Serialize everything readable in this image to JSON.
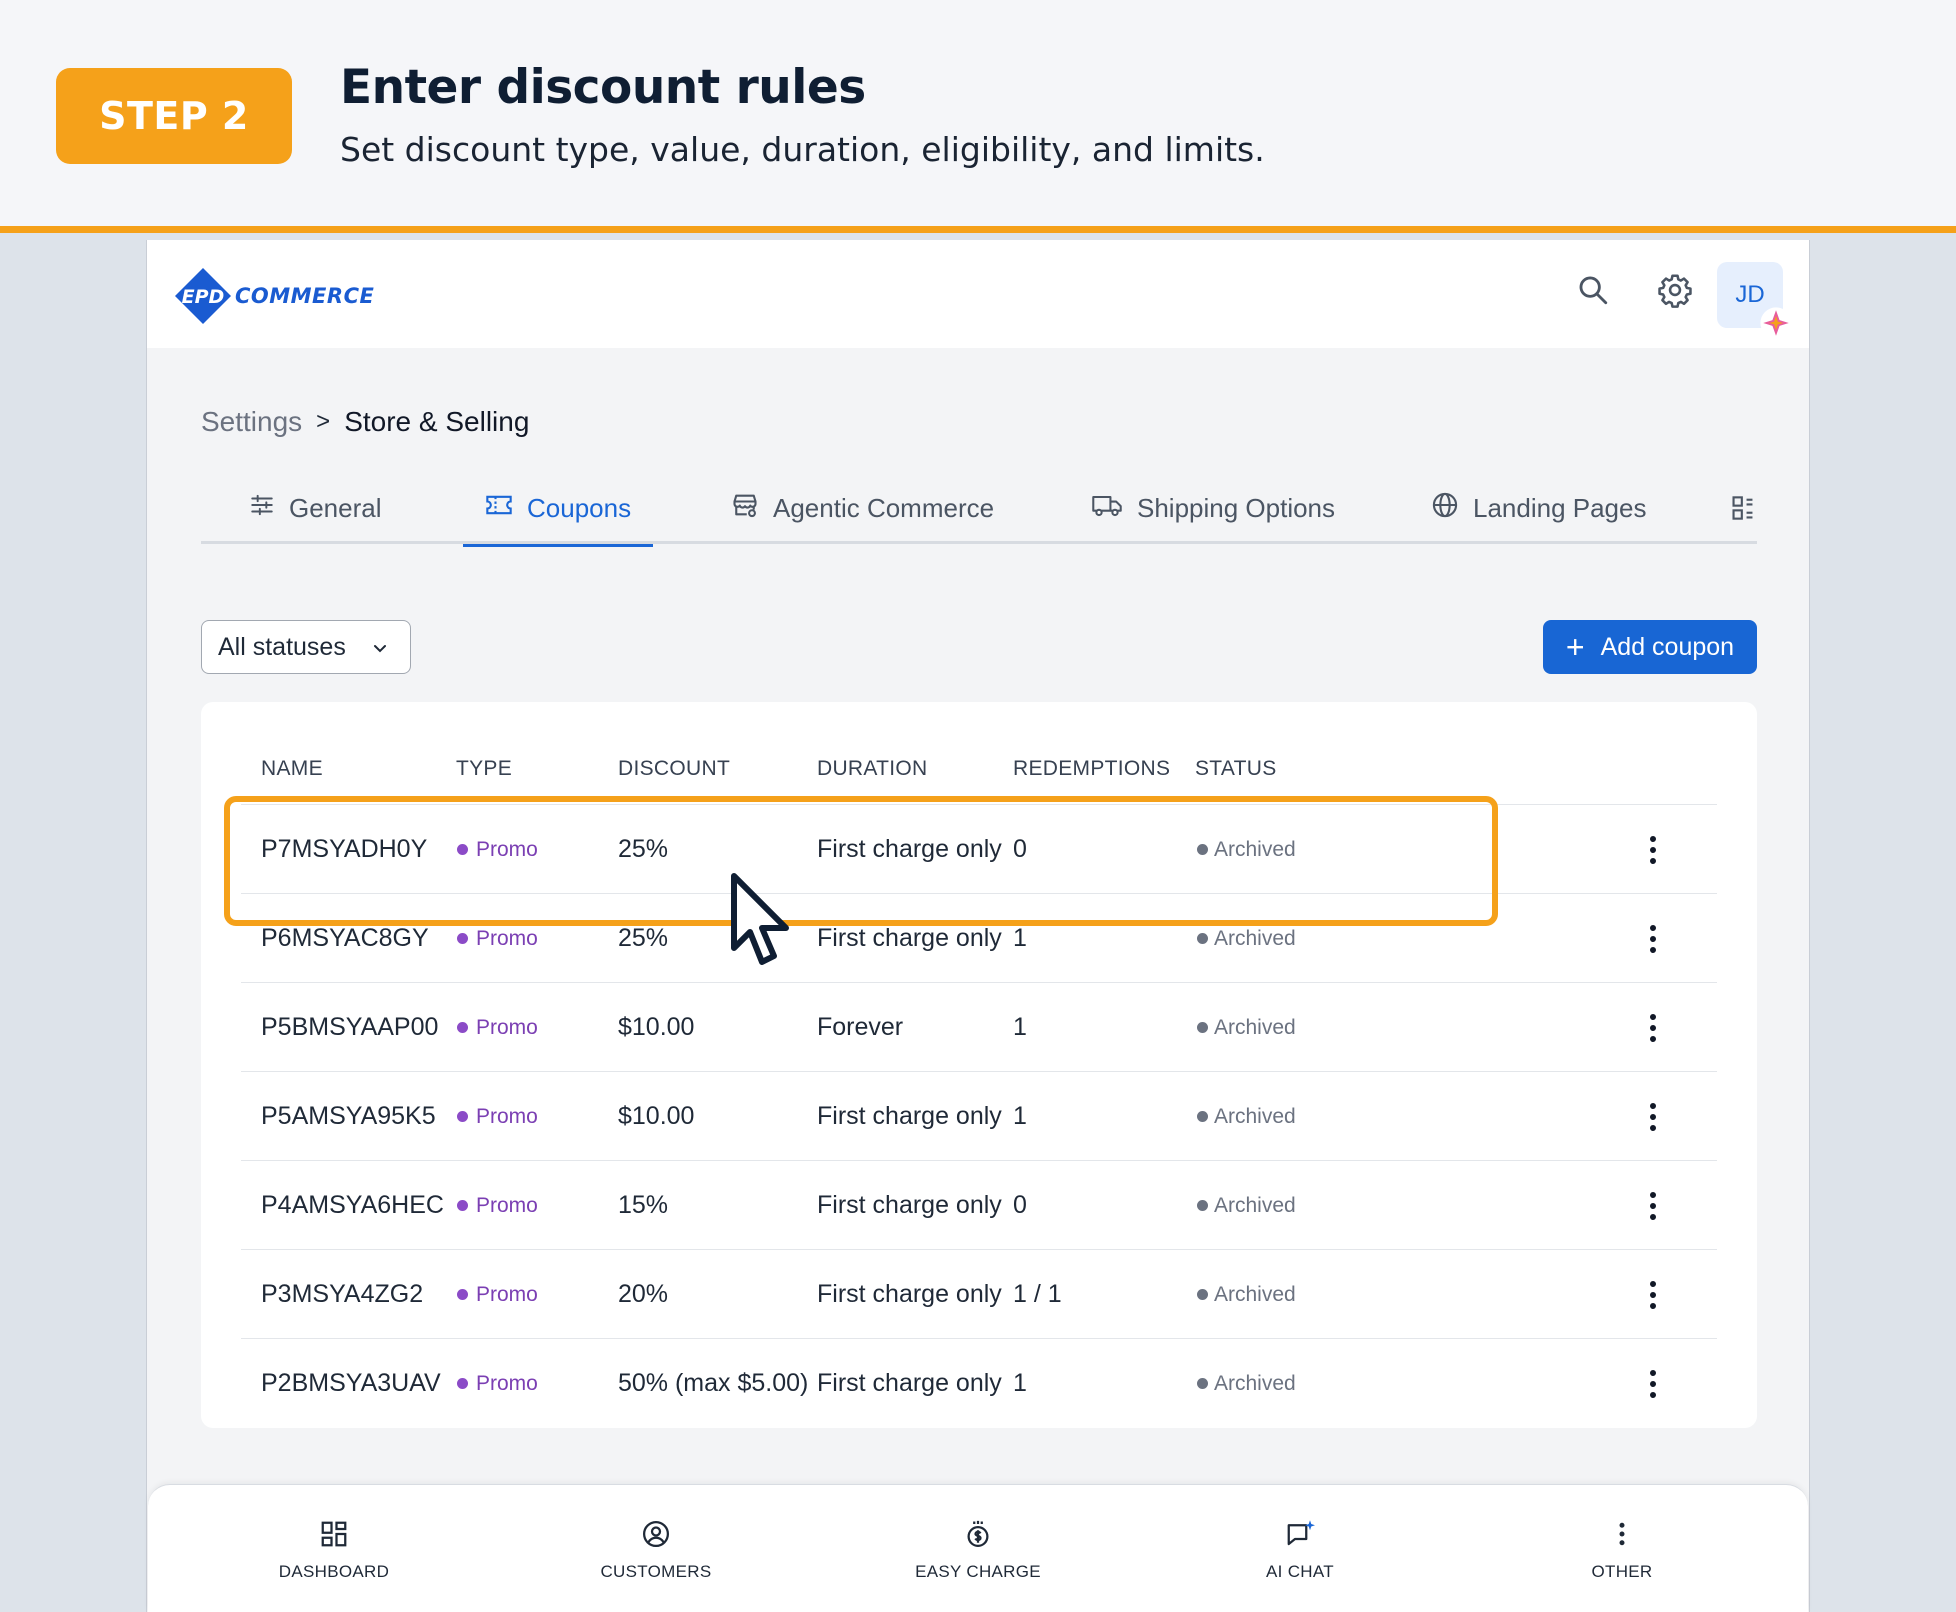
{
  "step": {
    "badge": "STEP 2",
    "title": "Enter discount rules",
    "subtitle": "Set discount type, value, duration, eligibility, and limits."
  },
  "app": {
    "logo_text": "COMMERCE",
    "logo_mark": "EPD",
    "avatar_initials": "JD"
  },
  "breadcrumb": {
    "root": "Settings",
    "separator": ">",
    "current": "Store & Selling"
  },
  "tabs": [
    {
      "label": "General",
      "icon": "sliders-icon",
      "active": false
    },
    {
      "label": "Coupons",
      "icon": "ticket-icon",
      "active": true
    },
    {
      "label": "Agentic Commerce",
      "icon": "store-icon",
      "active": false
    },
    {
      "label": "Shipping Options",
      "icon": "truck-icon",
      "active": false
    },
    {
      "label": "Landing Pages",
      "icon": "globe-icon",
      "active": false
    }
  ],
  "filter": {
    "selected": "All statuses"
  },
  "add_button": {
    "label": "Add coupon"
  },
  "table": {
    "columns": [
      "NAME",
      "TYPE",
      "DISCOUNT",
      "DURATION",
      "REDEMPTIONS",
      "STATUS"
    ],
    "rows": [
      {
        "name": "P7MSYADH0Y",
        "type": "Promo",
        "discount": "25%",
        "duration": "First charge only",
        "redemptions": "0",
        "status": "Archived"
      },
      {
        "name": "P6MSYAC8GY",
        "type": "Promo",
        "discount": "25%",
        "duration": "First charge only",
        "redemptions": "1",
        "status": "Archived"
      },
      {
        "name": "P5BMSYAAP00",
        "type": "Promo",
        "discount": "$10.00",
        "duration": "Forever",
        "redemptions": "1",
        "status": "Archived"
      },
      {
        "name": "P5AMSYA95K5",
        "type": "Promo",
        "discount": "$10.00",
        "duration": "First charge only",
        "redemptions": "1",
        "status": "Archived"
      },
      {
        "name": "P4AMSYA6HEC",
        "type": "Promo",
        "discount": "15%",
        "duration": "First charge only",
        "redemptions": "0",
        "status": "Archived"
      },
      {
        "name": "P3MSYA4ZG2",
        "type": "Promo",
        "discount": "20%",
        "duration": "First charge only",
        "redemptions": "1 / 1",
        "status": "Archived"
      },
      {
        "name": "P2BMSYA3UAV",
        "type": "Promo",
        "discount": "50% (max $5.00)",
        "duration": "First charge only",
        "redemptions": "1",
        "status": "Archived"
      }
    ]
  },
  "bottom_nav": [
    {
      "label": "DASHBOARD",
      "icon": "dashboard-icon"
    },
    {
      "label": "CUSTOMERS",
      "icon": "customer-icon"
    },
    {
      "label": "EASY CHARGE",
      "icon": "money-icon"
    },
    {
      "label": "AI CHAT",
      "icon": "chat-icon"
    },
    {
      "label": "OTHER",
      "icon": "more-icon"
    }
  ],
  "colors": {
    "step_accent": "#f5a11a",
    "primary": "#1866d4",
    "promo": "#7b3fb3",
    "archived": "#6b7280"
  }
}
